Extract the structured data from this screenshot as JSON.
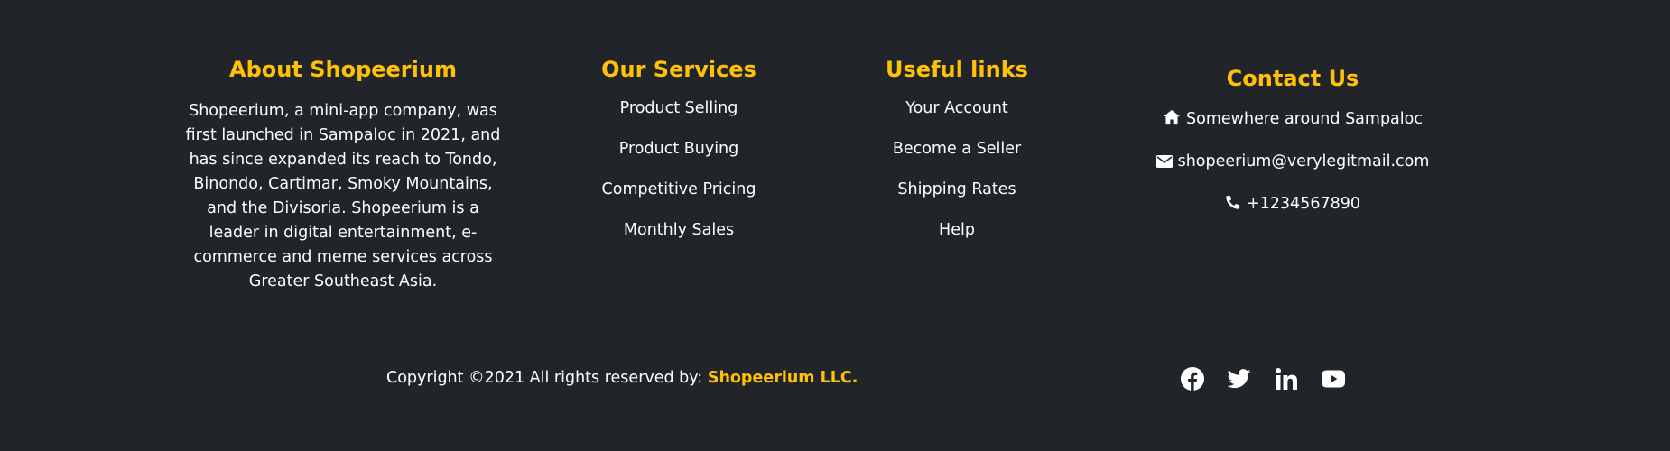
{
  "about": {
    "title": "About Shopeerium",
    "text": "Shopeerium, a mini-app company, was first launched in Sampaloc in 2021, and has since expanded its reach to Tondo, Binondo, Cartimar, Smoky Mountains, and the Divisoria. Shopeerium is a leader in digital entertainment, e-commerce and meme services across Greater Southeast Asia."
  },
  "services": {
    "title": "Our Services",
    "items": [
      "Product Selling",
      "Product Buying",
      "Competitive Pricing",
      "Monthly Sales"
    ]
  },
  "links": {
    "title": "Useful links",
    "items": [
      "Your Account",
      "Become a Seller",
      "Shipping Rates",
      "Help"
    ]
  },
  "contact": {
    "title": "Contact Us",
    "address": "Somewhere around Sampaloc",
    "email": "shopeerium@verylegitmail.com",
    "phone": "+1234567890"
  },
  "bottom": {
    "copyright_prefix": "Copyright ©2021 All rights reserved by:",
    "brand": "Shopeerium LLC."
  },
  "social": {
    "icons": [
      "facebook-icon",
      "twitter-icon",
      "linkedin-icon",
      "youtube-icon"
    ]
  },
  "colors": {
    "background": "#212529",
    "accent": "#ffc107",
    "text": "#ffffff"
  }
}
